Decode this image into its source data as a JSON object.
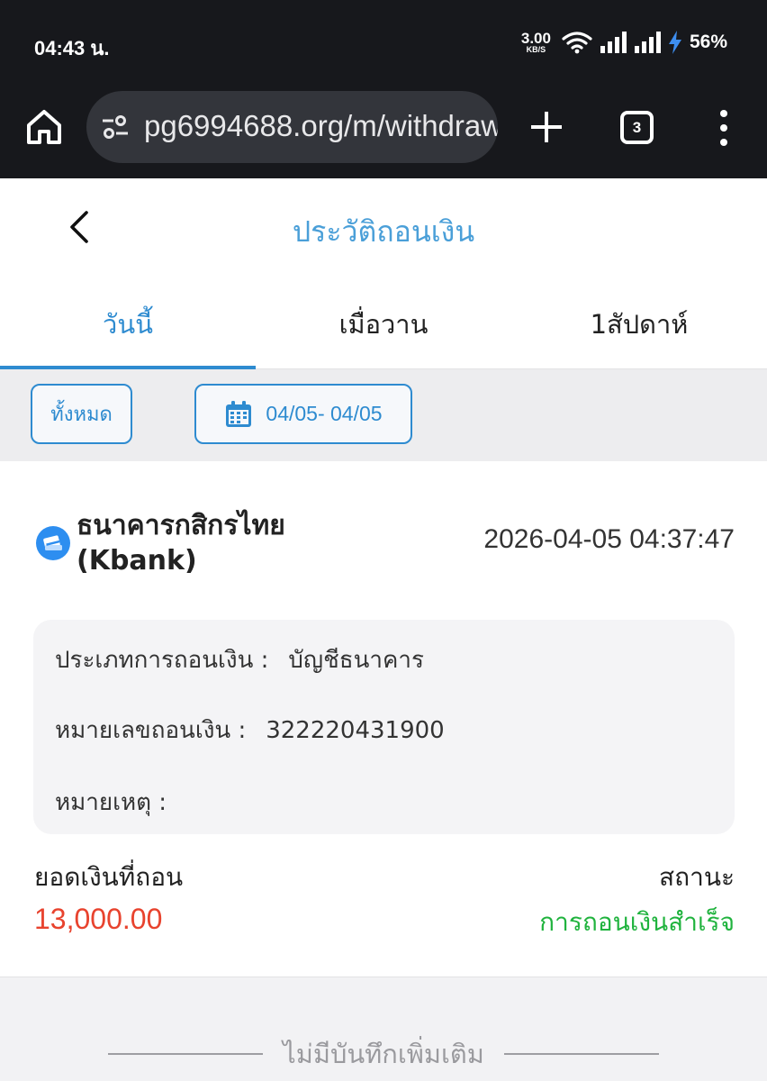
{
  "status_bar": {
    "time": "04:43 น.",
    "net_speed_value": "3.00",
    "net_speed_unit": "KB/S",
    "battery": "56%"
  },
  "browser": {
    "url": "pg6994688.org/m/withdraw",
    "tab_count": "3"
  },
  "header": {
    "title": "ประวัติถอนเงิน"
  },
  "tabs": [
    {
      "label": "วันนี้"
    },
    {
      "label": "เมื่อวาน"
    },
    {
      "label": "1สัปดาห์"
    }
  ],
  "filters": {
    "all_label": "ทั้งหมด",
    "date_range": "04/05- 04/05"
  },
  "record": {
    "bank_name": "ธนาคารกสิกรไทย (Kbank)",
    "datetime": "2026-04-05 04:37:47",
    "withdraw_type_label": "ประเภทการถอนเงิน :",
    "withdraw_type_value": "บัญชีธนาคาร",
    "withdraw_number_label": "หมายเลขถอนเงิน :",
    "withdraw_number_value": "322220431900",
    "note_label": "หมายเหตุ :",
    "amount_label": "ยอดเงินที่ถอน",
    "amount_value": "13,000.00",
    "status_label": "สถานะ",
    "status_value": "การถอนเงินสำเร็จ"
  },
  "footer": {
    "no_more": "ไม่มีบันทึกเพิ่มเติม"
  },
  "colors": {
    "accent": "#2e8bd0",
    "amount": "#e8432e",
    "success": "#20b33e"
  }
}
